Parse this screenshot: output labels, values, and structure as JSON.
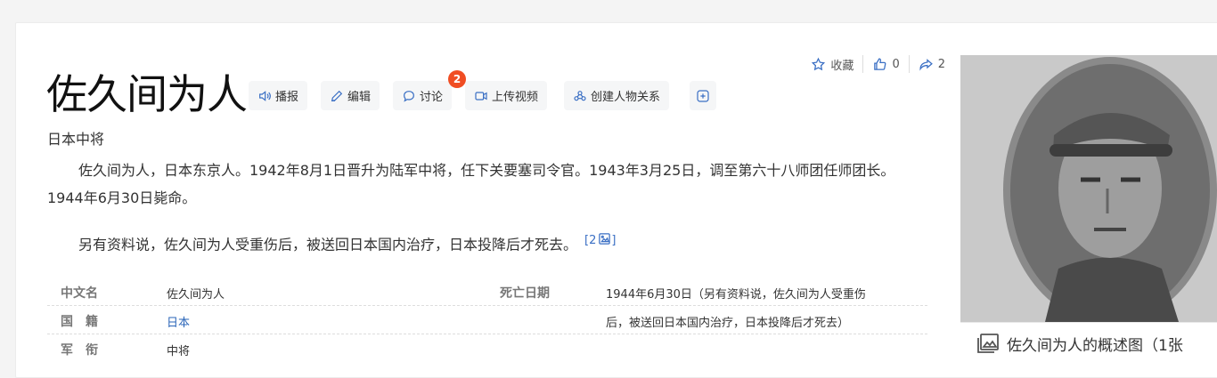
{
  "entry": {
    "title": "佐久间为人",
    "subtitle": "日本中将"
  },
  "toolbar": {
    "broadcast": "播报",
    "edit": "编辑",
    "discuss": "讨论",
    "discuss_badge": "2",
    "upload_video": "上传视频",
    "create_relation": "创建人物关系"
  },
  "actions": {
    "collect": "收藏",
    "like_count": "0",
    "share_count": "2"
  },
  "summary": {
    "p1": "佐久间为人，日本东京人。1942年8月1日晋升为陆军中将，任下关要塞司令官。1943年3月25日，调至第六十八师团任师团长。1944年6月30日毙命。",
    "p2": "另有资料说，佐久间为人受重伤后，被送回日本国内治疗，日本投降后才死去。",
    "cite": "[2"
  },
  "info": {
    "name_label": "中文名",
    "name_value": "佐久间为人",
    "nationality_label": "国　籍",
    "nationality_value": "日本",
    "rank_label": "军　衔",
    "rank_value": "中将",
    "death_label": "死亡日期",
    "death_value_1": "1944年6月30日（另有资料说，佐久间为人受重伤",
    "death_value_2": "后，被送回日本国内治疗，日本投降后才死去）"
  },
  "album": {
    "caption": "佐久间为人的概述图（1张"
  },
  "colors": {
    "accent": "#3a6fc4",
    "badge": "#f04d23",
    "link": "#2a65b8"
  }
}
